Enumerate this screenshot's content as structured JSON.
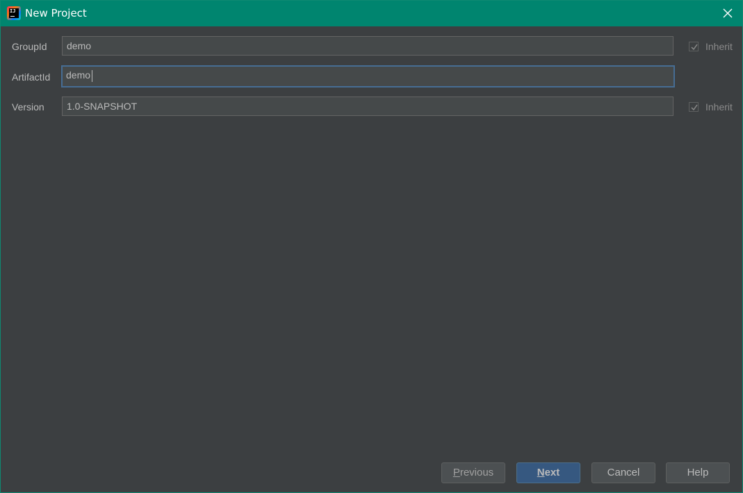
{
  "window": {
    "title": "New Project",
    "accent_color": "#00856f",
    "app_icon": "intellij-idea-icon",
    "app_icon_text": "IJ"
  },
  "form": {
    "group_id": {
      "label": "GroupId",
      "value": "demo",
      "inherit_label": "Inherit",
      "inherit_checked": true
    },
    "artifact_id": {
      "label": "ArtifactId",
      "value": "demo"
    },
    "version": {
      "label": "Version",
      "value": "1.0-SNAPSHOT",
      "inherit_label": "Inherit",
      "inherit_checked": true
    }
  },
  "buttons": {
    "previous_first": "P",
    "previous_rest": "revious",
    "next_first": "N",
    "next_rest": "ext",
    "cancel": "Cancel",
    "help": "Help"
  }
}
